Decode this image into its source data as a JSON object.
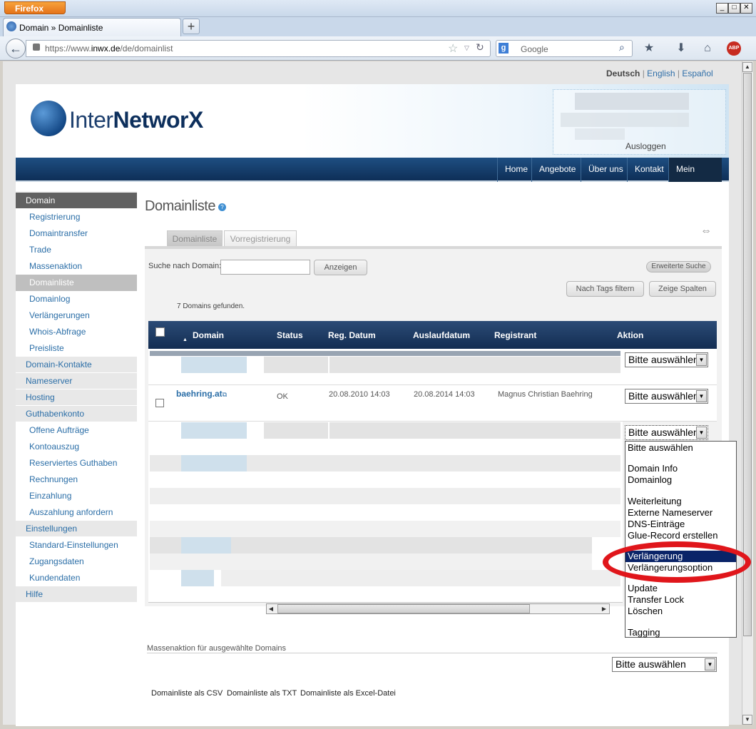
{
  "browser": {
    "app_button": "Firefox",
    "tab_title": "Domain » Domainliste",
    "url_prefix": "https://www.",
    "url_domain": "inwx.de",
    "url_path": "/de/domainlist",
    "search_engine_placeholder": "Google"
  },
  "languages": {
    "current": "Deutsch",
    "sep": "|",
    "en": "English",
    "es": "Español"
  },
  "header": {
    "logo_light": "Inter",
    "logo_bold": "NetworX",
    "logout": "Ausloggen"
  },
  "topnav": [
    "Home",
    "Angebote",
    "Über uns",
    "Kontakt",
    "Mein Konto"
  ],
  "sidebar": [
    {
      "label": "Domain",
      "level": 1,
      "state": "header"
    },
    {
      "label": "Registrierung",
      "level": 2
    },
    {
      "label": "Domaintransfer",
      "level": 2
    },
    {
      "label": "Trade",
      "level": 2
    },
    {
      "label": "Massenaktion",
      "level": 2
    },
    {
      "label": "Domainliste",
      "level": 2,
      "state": "selected"
    },
    {
      "label": "Domainlog",
      "level": 2
    },
    {
      "label": "Verlängerungen",
      "level": 2
    },
    {
      "label": "Whois-Abfrage",
      "level": 2
    },
    {
      "label": "Preisliste",
      "level": 2
    },
    {
      "label": "Domain-Kontakte",
      "level": 1
    },
    {
      "label": "Nameserver",
      "level": 1
    },
    {
      "label": "Hosting",
      "level": 1
    },
    {
      "label": "Guthabenkonto",
      "level": 1
    },
    {
      "label": "Offene Aufträge",
      "level": 2
    },
    {
      "label": "Kontoauszug",
      "level": 2
    },
    {
      "label": "Reserviertes Guthaben",
      "level": 2
    },
    {
      "label": "Rechnungen",
      "level": 2
    },
    {
      "label": "Einzahlung",
      "level": 2
    },
    {
      "label": "Auszahlung anfordern",
      "level": 2
    },
    {
      "label": "Einstellungen",
      "level": 1
    },
    {
      "label": "Standard-Einstellungen",
      "level": 2
    },
    {
      "label": "Zugangsdaten",
      "level": 2
    },
    {
      "label": "Kundendaten",
      "level": 2
    },
    {
      "label": "Hilfe",
      "level": 1
    }
  ],
  "main": {
    "title": "Domainliste",
    "help_icon": "?",
    "tabs": [
      "Domainliste",
      "Vorregistrierung"
    ],
    "search_label": "Suche nach Domain:",
    "search_value": "",
    "show_button": "Anzeigen",
    "advanced_search": "Erweiterte Suche",
    "filter_tags_button": "Nach Tags filtern",
    "show_columns_button": "Zeige Spalten",
    "found_text": "7 Domains gefunden."
  },
  "table": {
    "columns": [
      "Domain",
      "Status",
      "Reg. Datum",
      "Auslaufdatum",
      "Registrant",
      "Aktion"
    ],
    "visible_row": {
      "domain": "baehring.at",
      "status": "OK",
      "reg_date": "20.08.2010 14:03",
      "expiry": "20.08.2014 14:03",
      "registrant": "Magnus Christian Baehring"
    },
    "select_default": "Bitte auswählen"
  },
  "dropdown": {
    "options": [
      {
        "label": "Bitte auswählen"
      },
      {
        "label": ""
      },
      {
        "label": "Domain Info"
      },
      {
        "label": "Domainlog"
      },
      {
        "label": ""
      },
      {
        "label": "Weiterleitung"
      },
      {
        "label": "Externe Nameserver"
      },
      {
        "label": "DNS-Einträge"
      },
      {
        "label": "Glue-Record erstellen"
      },
      {
        "label": "Verlängerung",
        "highlighted": true
      },
      {
        "label": "Verlängerungsoption"
      },
      {
        "label": ""
      },
      {
        "label": "Update"
      },
      {
        "label": "Transfer Lock"
      },
      {
        "label": "Löschen"
      },
      {
        "label": ""
      },
      {
        "label": "Tagging"
      }
    ]
  },
  "mass_action": {
    "label": "Massenaktion für ausgewählte Domains",
    "select": "Bitte auswählen"
  },
  "exports": [
    "Domainliste als CSV",
    "Domainliste als TXT",
    "Domainliste als Excel-Datei"
  ],
  "colors": {
    "nav_dark": "#0e2f57",
    "link": "#2b6ea7",
    "highlight": "#0a2468",
    "ring": "#e0161b"
  }
}
